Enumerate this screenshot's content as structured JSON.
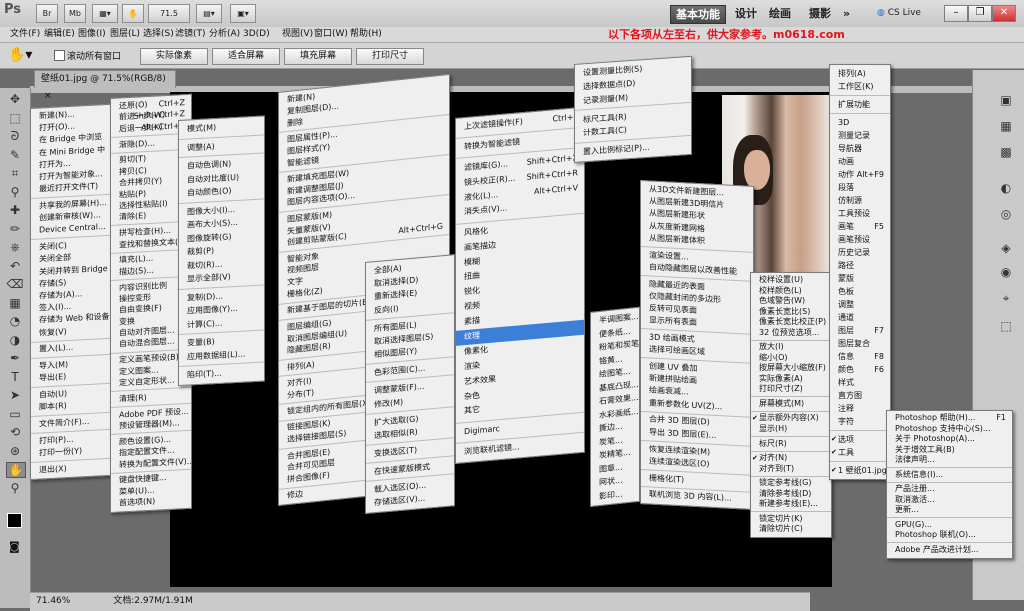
{
  "titlebar": {
    "app_icon": "Ps",
    "br_label": "Br",
    "mb_label": "Mb",
    "zoom": "71.5",
    "workspaces": [
      "基本功能",
      "设计",
      "绘画",
      "摄影"
    ],
    "more": "»",
    "cs_live": "CS Live"
  },
  "menubar": {
    "items": [
      "文件(F)",
      "编辑(E)",
      "图像(I)",
      "图层(L)",
      "选择(S)",
      "滤镜(T)",
      "分析(A)",
      "3D(D)",
      "视图(V)",
      "窗口(W)",
      "帮助(H)"
    ],
    "promo": "以下各项从左至右，供大家参考。m0618.com"
  },
  "options": {
    "scroll_all": "滚动所有窗口",
    "buttons": [
      "实际像素",
      "适合屏幕",
      "填充屏幕",
      "打印尺寸"
    ]
  },
  "document": {
    "tab": "壁纸01.jpg @ 71.5%(RGB/8)",
    "close": "×"
  },
  "status": {
    "zoom": "71.46%",
    "doc": "文档:2.97M/1.91M"
  },
  "menus": {
    "file": [
      "新建(N)...",
      "打开(O)...",
      "在 Bridge 中浏览",
      "在 Mini Bridge 中",
      "打开为...",
      "打开为智能对象...",
      "最近打开文件(T)",
      "",
      "共享我的屏幕(H)...",
      "创建新审核(W)...",
      "Device Central...",
      "",
      "关闭(C)",
      "关闭全部",
      "关闭并转到 Bridge",
      "存储(S)",
      "存储为(A)...",
      "签入(I)...",
      "存储为 Web 和设备",
      "恢复(V)",
      "",
      "置入(L)...",
      "",
      "导入(M)",
      "导出(E)",
      "",
      "自动(U)",
      "脚本(R)",
      "",
      "文件简介(F)...",
      "",
      "打印(P)...",
      "打印一份(Y)",
      "",
      "退出(X)"
    ],
    "edit": [
      "还原(O)",
      "前进一步(W)",
      "后退一步(K)",
      "",
      "渐隐(D)...",
      "",
      "剪切(T)",
      "拷贝(C)",
      "合并拷贝(Y)",
      "粘贴(P)",
      "选择性粘贴(I)",
      "清除(E)",
      "",
      "拼写检查(H)...",
      "查找和替换文本(X)",
      "",
      "填充(L)...",
      "描边(S)...",
      "",
      "内容识别比例",
      "操控变形",
      "自由变换(F)",
      "变换",
      "自动对齐图层...",
      "自动混合图层...",
      "",
      "定义画笔预设(B)...",
      "定义图案...",
      "定义自定形状...",
      "",
      "清理(R)",
      "",
      "Adobe PDF 预设...",
      "预设管理器(M)...",
      "",
      "颜色设置(G)...",
      "指定配置文件...",
      "转换为配置文件(V)...",
      "",
      "键盘快捷键...",
      "菜单(U)...",
      "首选项(N)"
    ],
    "edit_shortcuts": [
      "Ctrl+Z",
      "Shift+Ctrl+Z",
      "Alt+Ctrl+Z"
    ],
    "image": [
      "模式(M)",
      "",
      "调整(A)",
      "",
      "自动色调(N)",
      "自动对比度(U)",
      "自动颜色(O)",
      "",
      "图像大小(I)...",
      "画布大小(S)...",
      "图像旋转(G)",
      "裁剪(P)",
      "裁切(R)...",
      "显示全部(V)",
      "",
      "复制(D)...",
      "应用图像(Y)...",
      "计算(C)...",
      "",
      "变量(B)",
      "应用数据组(L)...",
      "",
      "陷印(T)..."
    ],
    "layer": [
      "新建(N)",
      "复制图层(D)...",
      "删除",
      "",
      "图层属性(P)...",
      "图层样式(Y)",
      "智能滤镜",
      "",
      "新建填充图层(W)",
      "新建调整图层(J)",
      "图层内容选项(O)...",
      "",
      "图层蒙版(M)",
      "矢量蒙版(V)",
      "创建剪贴蒙版(C)",
      "",
      "智能对象",
      "视频图层",
      "文字",
      "栅格化(Z)",
      "",
      "新建基于图层的切片(B)",
      "",
      "图层编组(G)",
      "取消图层编组(U)",
      "隐藏图层(R)",
      "",
      "排列(A)",
      "",
      "对齐(I)",
      "分布(T)",
      "",
      "锁定组内的所有图层(X)...",
      "",
      "链接图层(K)",
      "选择链接图层(S)",
      "",
      "合并图层(E)",
      "合并可见图层",
      "拼合图像(F)",
      "",
      "修边"
    ],
    "layer_shortcut": "Alt+Ctrl+G",
    "select": [
      "全部(A)",
      "取消选择(D)",
      "重新选择(E)",
      "反向(I)",
      "",
      "所有图层(L)",
      "取消选择图层(S)",
      "相似图层(Y)",
      "",
      "色彩范围(C)...",
      "",
      "调整蒙版(F)...",
      "修改(M)",
      "",
      "扩大选取(G)",
      "选取相似(R)",
      "",
      "变换选区(T)",
      "",
      "在快速蒙版模式",
      "",
      "载入选区(O)...",
      "存储选区(V)..."
    ],
    "filter": [
      "上次滤镜操作(F)",
      "",
      "转换为智能滤镜",
      "",
      "滤镜库(G)...",
      "镜头校正(R)...",
      "液化(L)...",
      "消失点(V)...",
      "",
      "风格化",
      "画笔描边",
      "模糊",
      "扭曲",
      "锐化",
      "视频",
      "素描",
      "纹理",
      "像素化",
      "渲染",
      "艺术效果",
      "杂色",
      "其它",
      "",
      "Digimarc",
      "",
      "浏览联机滤镜..."
    ],
    "filter_shortcuts": [
      "Ctrl+F",
      "Shift+Ctrl+X",
      "Shift+Ctrl+R",
      "Alt+Ctrl+V"
    ],
    "sketch": [
      "半调图案...",
      "便条纸...",
      "粉笔和炭笔...",
      "铬黄...",
      "绘图笔...",
      "基底凸现...",
      "石膏效果...",
      "水彩画纸...",
      "撕边...",
      "炭笔...",
      "炭精笔...",
      "图章...",
      "网状...",
      "影印..."
    ],
    "analysis": [
      "设置测量比例(S)",
      "选择数据点(D)",
      "记录测量(M)",
      "",
      "标尺工具(R)",
      "计数工具(C)",
      "",
      "置入比例标记(P)..."
    ],
    "threed": [
      "从3D文件新建图层...",
      "从图层新建3D明信片",
      "从图层新建形状",
      "从灰度新建网格",
      "从图层新建体积",
      "",
      "渲染设置...",
      "自动隐藏图层以改善性能",
      "",
      "隐藏最近的表面",
      "仅隐藏封闭的多边形",
      "反转可见表面",
      "显示所有表面",
      "",
      "3D 绘画模式",
      "选择可绘画区域",
      "",
      "创建 UV 叠加",
      "新建拼贴绘画",
      "绘画衰减...",
      "重新参数化 UV(Z)...",
      "",
      "合并 3D 图层(D)",
      "导出 3D 图层(E)...",
      "",
      "恢复连续渲染(M)",
      "连续渲染选区(O)",
      "",
      "栅格化(T)",
      "",
      "联机浏览 3D 内容(L)..."
    ],
    "view": [
      "校样设置(U)",
      "校样颜色(L)",
      "色域警告(W)",
      "像素长宽比(S)",
      "像素长宽比校正(P)",
      "32 位预览选项...",
      "",
      "放大(I)",
      "缩小(O)",
      "按屏幕大小缩放(F)",
      "实际像素(A)",
      "打印尺寸(Z)",
      "",
      "屏幕模式(M)",
      "",
      "显示额外内容(X)",
      "显示(H)",
      "",
      "标尺(R)",
      "",
      "对齐(N)",
      "对齐到(T)",
      "",
      "锁定参考线(G)",
      "清除参考线(D)",
      "新建参考线(E)...",
      "",
      "锁定切片(K)",
      "清除切片(C)"
    ],
    "window": [
      "排列(A)",
      "工作区(K)",
      "",
      "扩展功能",
      "",
      "3D",
      "测量记录",
      "导航器",
      "动画",
      "动作",
      "段落",
      "仿制源",
      "工具预设",
      "画笔",
      "画笔预设",
      "历史记录",
      "路径",
      "蒙版",
      "色板",
      "调整",
      "通道",
      "图层",
      "图层复合",
      "信息",
      "颜色",
      "样式",
      "直方图",
      "注释",
      "字符",
      "",
      "选项",
      "工具",
      "",
      "1 壁纸01.jpg"
    ],
    "window_shortcuts": [
      "Alt+F9",
      "F5",
      "F7",
      "F8",
      "F6"
    ],
    "help": [
      "Photoshop 帮助(H)...",
      "Photoshop 支持中心(S)...",
      "关于 Photoshop(A)...",
      "关于增效工具(B)",
      "法律声明...",
      "",
      "系统信息(I)...",
      "",
      "产品注册...",
      "取消激活...",
      "更新...",
      "",
      "GPU(G)...",
      "Photoshop 联机(O)...",
      "",
      "Adobe 产品改进计划..."
    ],
    "help_shortcut": "F1"
  },
  "tools": [
    "move-icon",
    "marquee-icon",
    "lasso-icon",
    "quick-select-icon",
    "crop-icon",
    "eyedropper-icon",
    "healing-icon",
    "brush-icon",
    "stamp-icon",
    "history-brush-icon",
    "eraser-icon",
    "gradient-icon",
    "blur-icon",
    "dodge-icon",
    "pen-icon",
    "type-icon",
    "path-select-icon",
    "shape-icon",
    "3d-rotate-icon",
    "3d-orbit-icon",
    "hand-icon",
    "zoom-icon"
  ],
  "colors": {
    "accent": "#3b7fd9",
    "promo": "#e0141e",
    "canvas": "#000000"
  }
}
